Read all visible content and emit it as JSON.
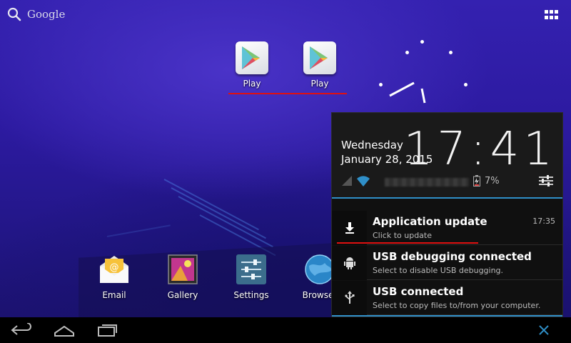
{
  "search": {
    "label": "Google",
    "icon": "search-icon"
  },
  "apps_button": {
    "icon": "all-apps-grid-icon"
  },
  "home_apps": [
    {
      "label": "Play",
      "icon": "play-store-icon"
    },
    {
      "label": "Play",
      "icon": "play-store-icon"
    }
  ],
  "dock": [
    {
      "label": "Email",
      "icon": "email-icon"
    },
    {
      "label": "Gallery",
      "icon": "gallery-icon"
    },
    {
      "label": "Settings",
      "icon": "settings-icon"
    },
    {
      "label": "Browser",
      "icon": "browser-icon"
    }
  ],
  "notification_panel": {
    "day": "Wednesday",
    "date": "January 28, 2015",
    "time": "17:41",
    "battery": "7%",
    "accent_color": "#2f8fc8",
    "notifications": [
      {
        "title": "Application update",
        "subtitle": "Click to update",
        "time": "17:35",
        "icon": "download-icon"
      },
      {
        "title": "USB debugging connected",
        "subtitle": "Select to disable USB debugging.",
        "time": "",
        "icon": "android-debug-icon"
      },
      {
        "title": "USB connected",
        "subtitle": "Select to copy files to/from your computer.",
        "time": "",
        "icon": "usb-icon"
      }
    ]
  },
  "navbar": {
    "back": "back-icon",
    "home": "home-icon",
    "recents": "recents-icon",
    "close": "close-icon"
  }
}
